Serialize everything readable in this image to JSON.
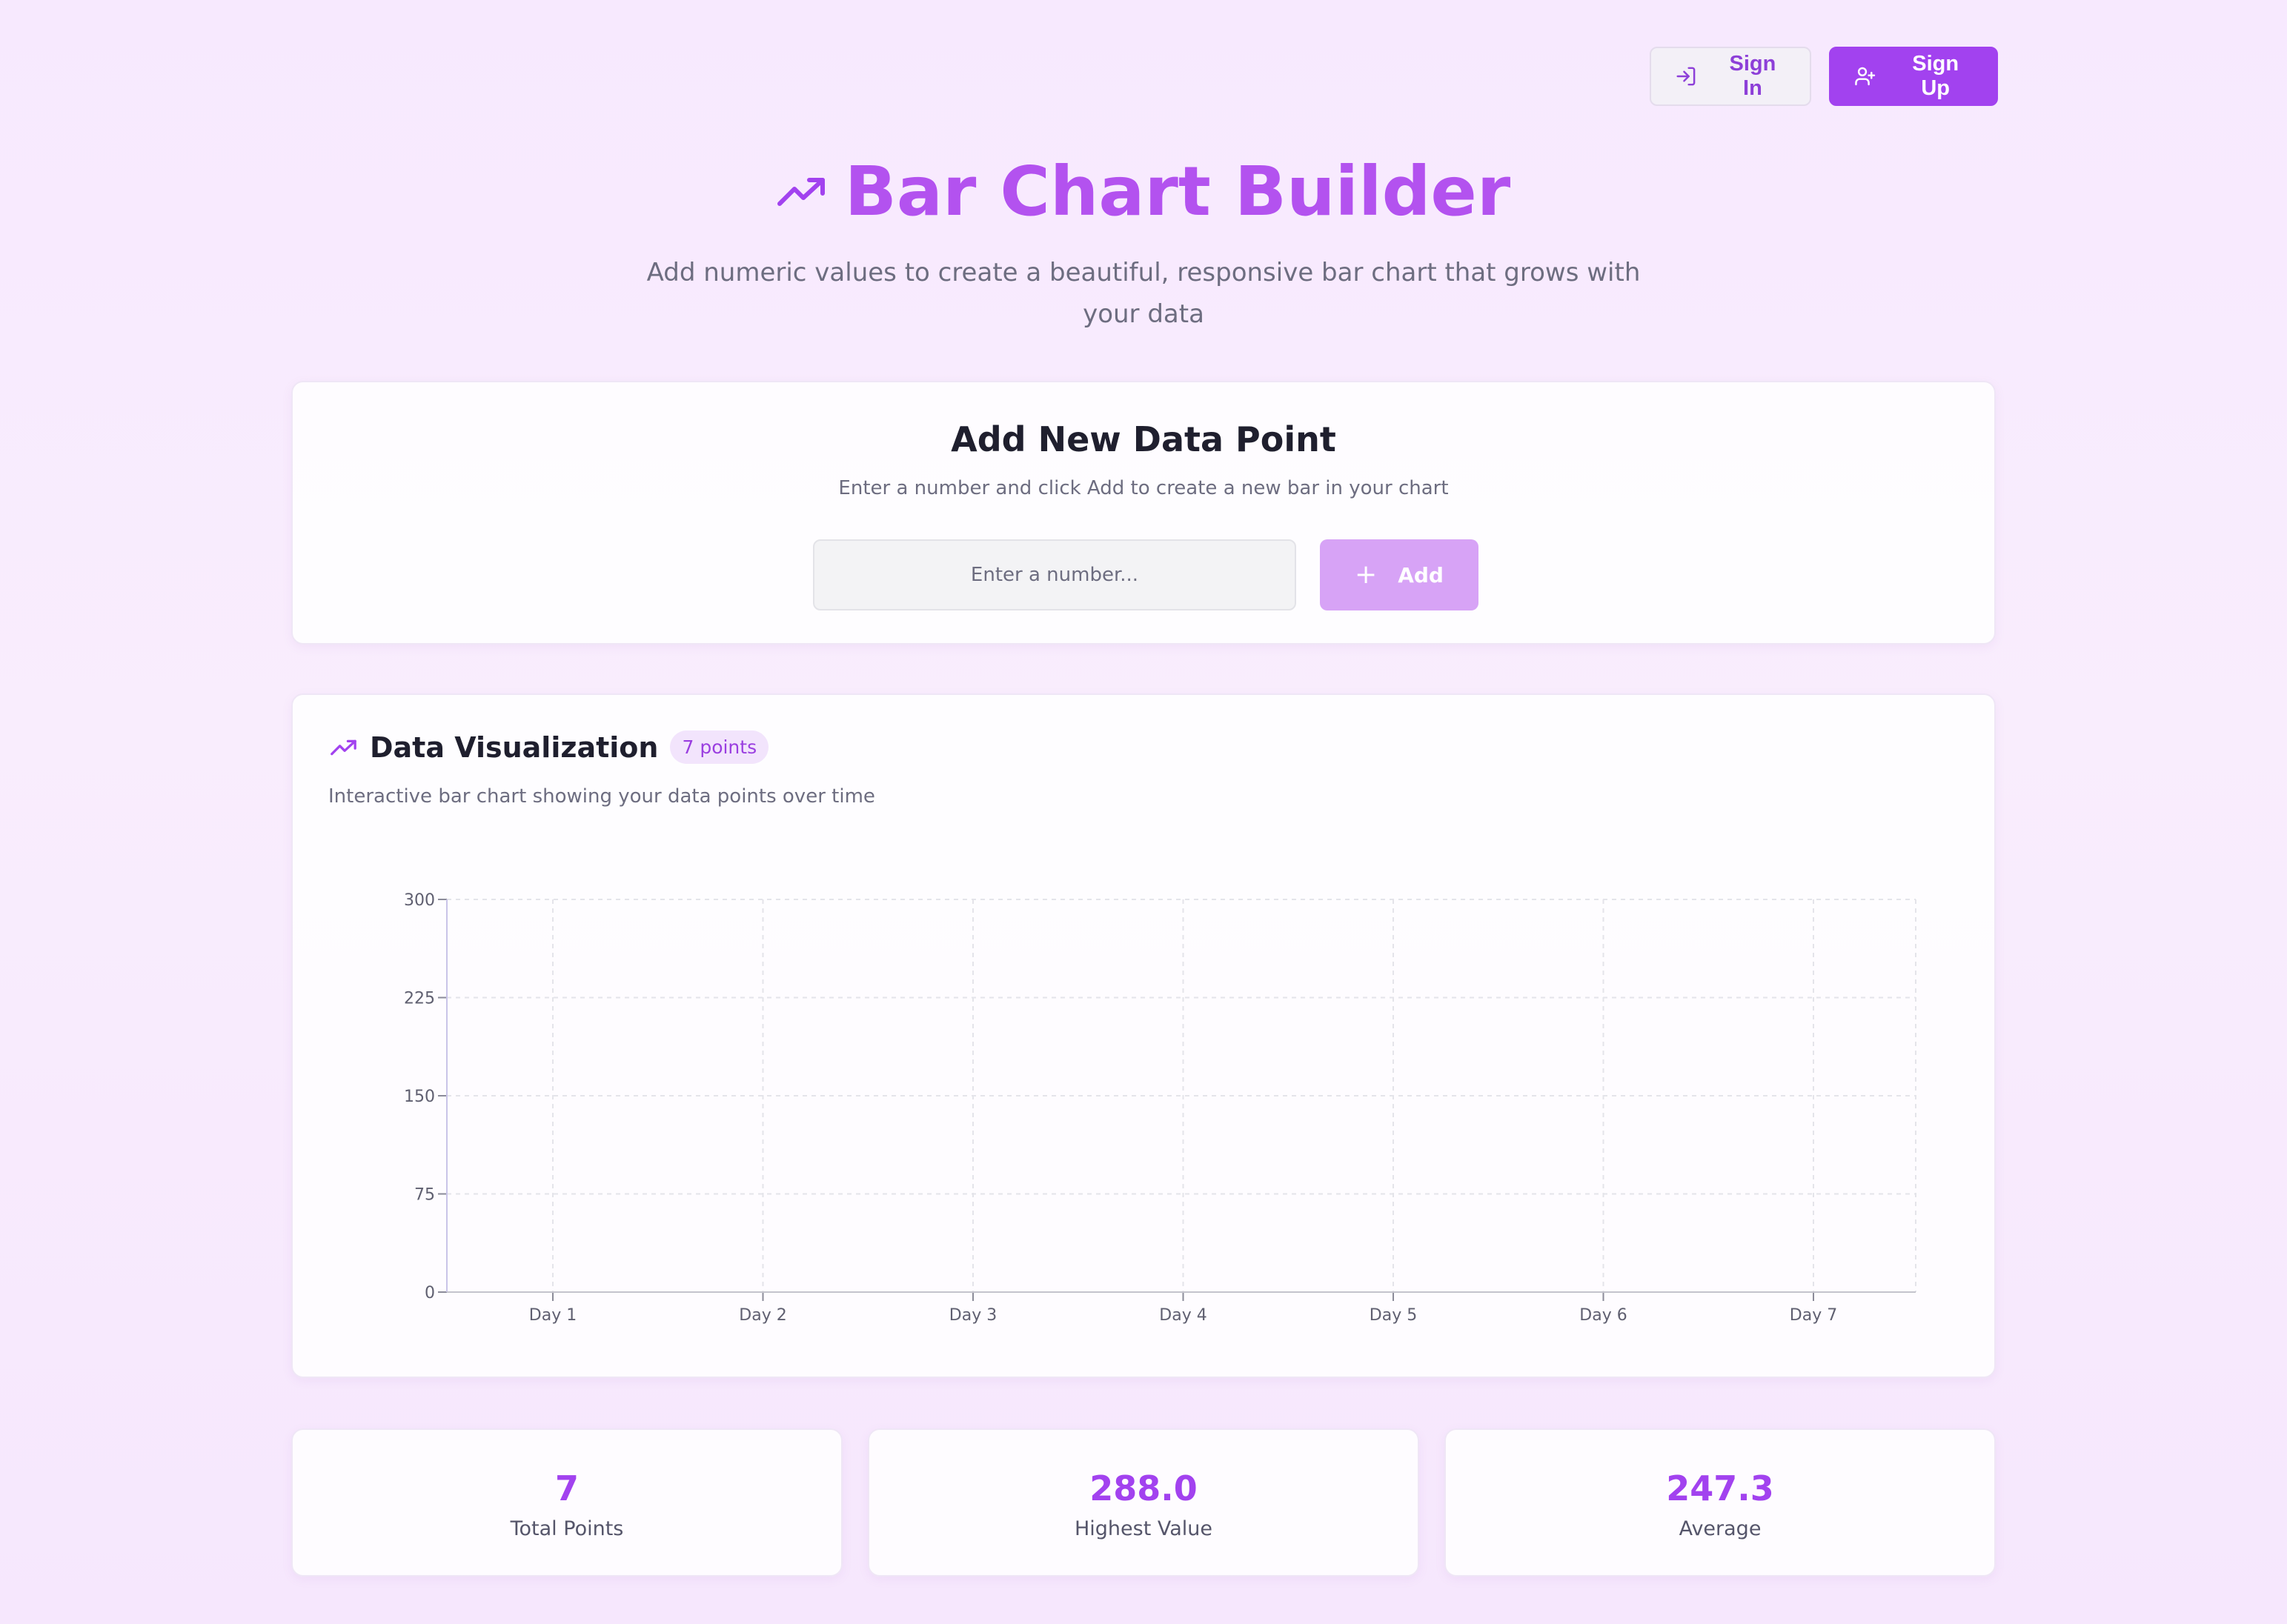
{
  "auth": {
    "sign_in_label": "Sign In",
    "sign_up_label": "Sign Up"
  },
  "hero": {
    "title": "Bar Chart Builder",
    "subtitle": "Add numeric values to create a beautiful, responsive bar chart that grows with your data"
  },
  "add_panel": {
    "title": "Add New Data Point",
    "subtitle": "Enter a number and click Add to create a new bar in your chart",
    "input_placeholder": "Enter a number...",
    "input_value": "",
    "add_label": "Add"
  },
  "visualization": {
    "title": "Data Visualization",
    "badge": "7 points",
    "subtitle": "Interactive bar chart showing your data points over time"
  },
  "chart_data": {
    "type": "bar",
    "categories": [
      "Day 1",
      "Day 2",
      "Day 3",
      "Day 4",
      "Day 5",
      "Day 6",
      "Day 7"
    ],
    "values": [
      null,
      null,
      null,
      null,
      null,
      null,
      null
    ],
    "ylim": [
      0,
      300
    ],
    "yticks": [
      0,
      75,
      150,
      225,
      300
    ],
    "grid": true
  },
  "stats": [
    {
      "value": "7",
      "label": "Total Points"
    },
    {
      "value": "288.0",
      "label": "Highest Value"
    },
    {
      "value": "247.3",
      "label": "Average"
    }
  ],
  "colors": {
    "accent": "#a242ef",
    "accent_light": "#d7a3f6",
    "title": "#b352ef"
  },
  "icons": {
    "sign_in": "login-icon",
    "sign_up": "user-plus-icon",
    "hero": "trending-up-icon",
    "add": "plus-icon",
    "visualization": "trending-up-icon"
  }
}
